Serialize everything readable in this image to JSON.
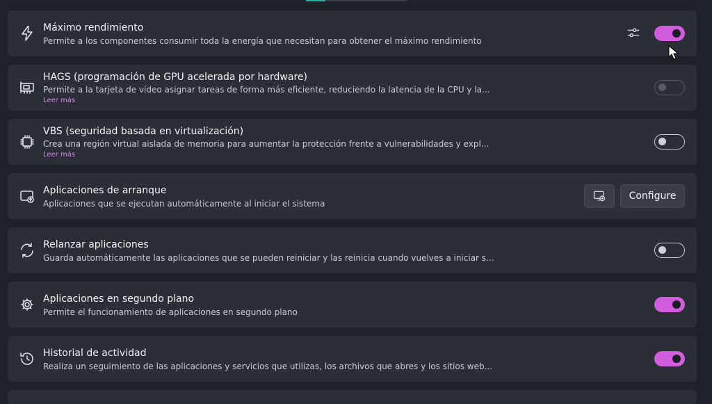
{
  "accent_color": "#d15cde",
  "link_color": "#d38ae8",
  "settings": [
    {
      "icon": "lightning-icon",
      "title": "Máximo rendimiento",
      "description": "Permite a los componentes consumir toda la energía que necesitan para obtener el máximo rendimiento",
      "toggle": "on",
      "extra_button_icon": "sliders-icon"
    },
    {
      "icon": "gpu-icon",
      "title": "HAGS (programación de GPU acelerada por hardware)",
      "description": "Permite a la tarjeta de vídeo asignar tareas de forma más eficiente, reduciendo la latencia de la CPU y la...",
      "link": "Leer más",
      "toggle": "disabled"
    },
    {
      "icon": "chip-icon",
      "title": "VBS (seguridad basada en virtualización)",
      "description": "Crea una región virtual aislada de memoria para aumentar la protección frente a vulnerabilidades y expl...",
      "link": "Leer más",
      "toggle": "off"
    },
    {
      "icon": "startup-apps-icon",
      "title": "Aplicaciones de arranque",
      "description": "Aplicaciones que se ejecutan automáticamente al iniciar el sistema",
      "button_icon": "add-startup-icon",
      "button_label": "Configure"
    },
    {
      "icon": "restart-icon",
      "title": "Relanzar aplicaciones",
      "description": "Guarda automáticamente las aplicaciones que se pueden reiniciar y las reinicia cuando vuelves a iniciar s...",
      "toggle": "off"
    },
    {
      "icon": "background-apps-icon",
      "title": "Aplicaciones en segundo plano",
      "description": "Permite el funcionamiento de aplicaciones en segundo plano",
      "toggle": "on"
    },
    {
      "icon": "history-icon",
      "title": "Historial de actividad",
      "description": "Realiza un seguimiento de las aplicaciones y servicios que utilizas, los archivos que abres y los sitios web...",
      "toggle": "on"
    }
  ]
}
